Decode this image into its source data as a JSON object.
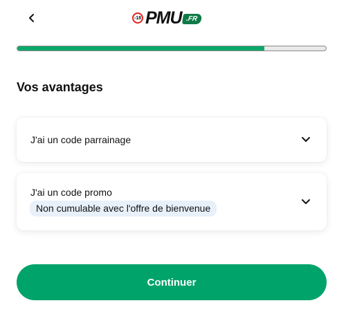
{
  "header": {
    "back_icon": "chevron-left-icon",
    "logo": {
      "age_badge": "-18",
      "brand": "PMU",
      "domain": ".FR",
      "badge_color": "#e2231a",
      "fr_color": "#0e7a47"
    }
  },
  "progress": {
    "value": 0.8,
    "fill_color": "#0ba86b",
    "track_color": "#e9e9e9"
  },
  "section": {
    "title": "Vos avantages"
  },
  "accordions": [
    {
      "label": "J'ai un code parrainage",
      "icon": "chevron-down-icon"
    },
    {
      "label": "J'ai un code promo",
      "note": "Non cumulable avec l'offre de bienvenue",
      "icon": "chevron-down-icon"
    }
  ],
  "actions": {
    "continue_label": "Continuer",
    "button_color": "#00a36a"
  }
}
